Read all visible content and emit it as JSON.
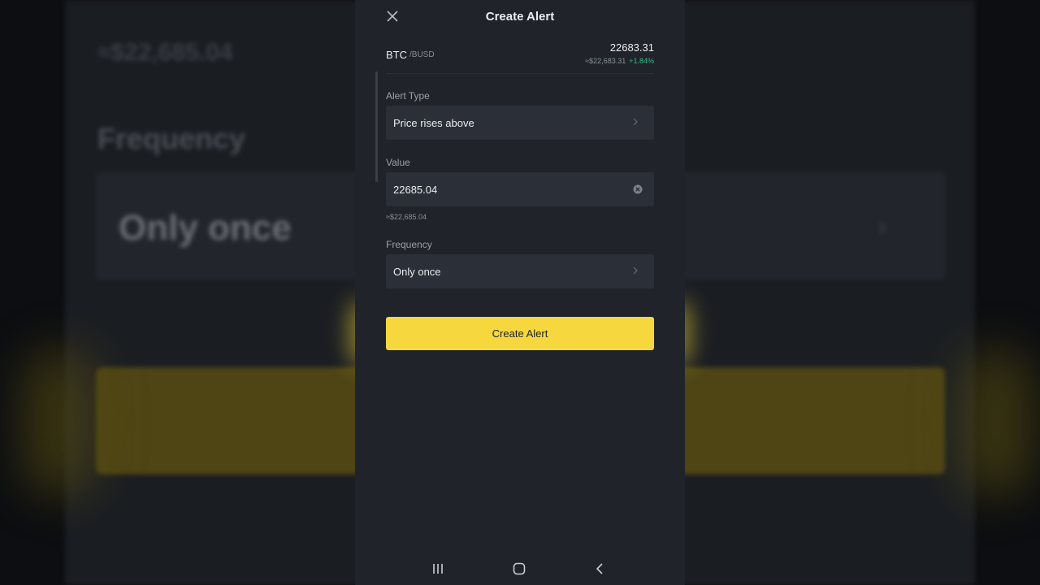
{
  "background": {
    "price": "≈$22,685.04",
    "frequency_label": "Frequency",
    "frequency_value": "Only once"
  },
  "header": {
    "title": "Create Alert",
    "close_icon": "close-icon"
  },
  "pair": {
    "base": "BTC",
    "quote": "/BUSD",
    "last_price": "22683.31",
    "approx_usd": "≈$22,683.31",
    "change": "+1.84%"
  },
  "form": {
    "alert_type": {
      "label": "Alert Type",
      "value": "Price rises above"
    },
    "value": {
      "label": "Value",
      "input": "22685.04",
      "approx": "≈$22,685.04"
    },
    "frequency": {
      "label": "Frequency",
      "value": "Only once"
    },
    "submit_label": "Create Alert"
  },
  "colors": {
    "accent_yellow": "#f6d83e",
    "positive_green": "#2ebd85",
    "screen_bg": "#20242a",
    "field_bg": "#2b3038"
  },
  "icons": {
    "nav_recents": "recents-icon",
    "nav_home": "home-icon",
    "nav_back": "back-icon",
    "chevron": "chevron-right-icon",
    "clear": "clear-icon"
  }
}
